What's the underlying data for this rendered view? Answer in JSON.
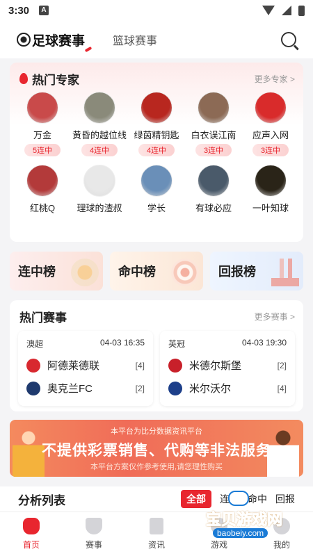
{
  "status_bar": {
    "time": "3:30",
    "notif_letter": "A"
  },
  "top_nav": {
    "tab_football": "足球赛事",
    "tab_basketball": "篮球赛事"
  },
  "experts": {
    "title": "热门专家",
    "more": "更多专家 >",
    "items": [
      {
        "name": "万金",
        "streak": "5连中",
        "color": "#c94a4a"
      },
      {
        "name": "黄昏的越位线",
        "streak": "4连中",
        "color": "#8a8a7a"
      },
      {
        "name": "绿茵精钥匙",
        "streak": "4连中",
        "color": "#b8271f"
      },
      {
        "name": "白衣误江南",
        "streak": "3连中",
        "color": "#8c6a55"
      },
      {
        "name": "应声入网",
        "streak": "3连中",
        "color": "#d92b2b"
      },
      {
        "name": "红桃Q",
        "streak": "",
        "color": "#b33a3a"
      },
      {
        "name": "理球的渣叔",
        "streak": "",
        "color": "#e8e8e8"
      },
      {
        "name": "学长",
        "streak": "",
        "color": "#6a8fb8"
      },
      {
        "name": "有球必应",
        "streak": "",
        "color": "#4a5a6a"
      },
      {
        "name": "一叶知球",
        "streak": "",
        "color": "#2a2418"
      }
    ]
  },
  "rankings": {
    "streak_rank": "连中榜",
    "hit_rank": "命中榜",
    "return_rank": "回报榜"
  },
  "matches": {
    "title": "热门赛事",
    "more": "更多赛事 >",
    "items": [
      {
        "league": "澳超",
        "date": "04-03 16:35",
        "home": "阿德莱德联",
        "home_score": "[4]",
        "home_color": "#d8282f",
        "away": "奥克兰FC",
        "away_score": "[2]",
        "away_color": "#1f3a6e"
      },
      {
        "league": "英冠",
        "date": "04-03 19:30",
        "home": "米德尔斯堡",
        "home_score": "[2]",
        "home_color": "#c8202a",
        "away": "米尔沃尔",
        "away_score": "[4]",
        "away_color": "#1d3f8a"
      }
    ]
  },
  "banner": {
    "top": "本平台为比分数据资讯平台",
    "main": "不提供彩票销售、代购等非法服务",
    "sub": "本平台方案仅作参考使用,请您理性购买"
  },
  "analysis": {
    "title": "分析列表",
    "filters": [
      "全部",
      "连中",
      "命中",
      "回报"
    ]
  },
  "tabbar": {
    "items": [
      "首页",
      "赛事",
      "资讯",
      "游戏",
      "我的"
    ]
  },
  "watermark": {
    "text": "宝贝游戏网",
    "url": "baobeiy.com"
  },
  "colors": {
    "accent": "#e8262f",
    "background": "#f4f4f6"
  }
}
